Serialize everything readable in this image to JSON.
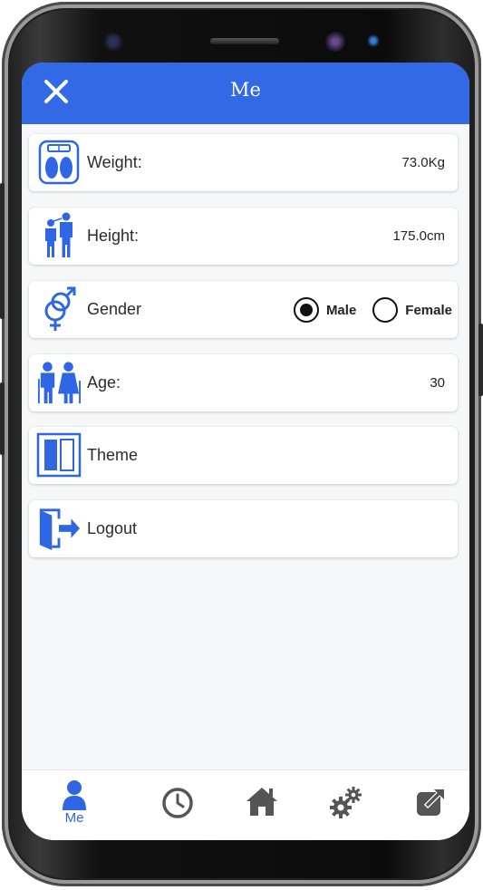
{
  "header": {
    "title": "Me",
    "close_icon": "close-icon"
  },
  "colors": {
    "accent": "#3169e6",
    "icon_blue": "#2f66e3",
    "nav_gray": "#555555"
  },
  "items": [
    {
      "key": "weight",
      "label": "Weight:",
      "value": "73.0Kg",
      "icon": "weight-scale-icon"
    },
    {
      "key": "height",
      "label": "Height:",
      "value": "175.0cm",
      "icon": "height-icon"
    },
    {
      "key": "gender",
      "label": "Gender",
      "icon": "gender-icon"
    },
    {
      "key": "age",
      "label": "Age:",
      "value": "30",
      "icon": "elderly-couple-icon"
    },
    {
      "key": "theme",
      "label": "Theme",
      "icon": "theme-icon"
    },
    {
      "key": "logout",
      "label": "Logout",
      "icon": "logout-door-icon"
    }
  ],
  "gender": {
    "options": [
      {
        "label": "Male",
        "selected": true
      },
      {
        "label": "Female",
        "selected": false
      }
    ]
  },
  "nav": {
    "items": [
      {
        "label": "Me",
        "icon": "user-icon",
        "active": true
      },
      {
        "label": "",
        "icon": "clock-icon",
        "active": false
      },
      {
        "label": "",
        "icon": "home-icon",
        "active": false
      },
      {
        "label": "",
        "icon": "gears-icon",
        "active": false
      },
      {
        "label": "",
        "icon": "share-icon",
        "active": false
      }
    ]
  }
}
